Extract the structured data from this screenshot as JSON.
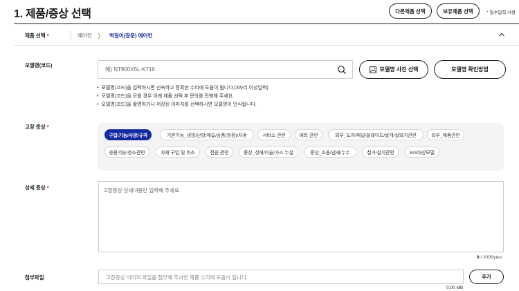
{
  "header": {
    "title": "1. 제품/증상 선택",
    "other_product_btn": "다른제품 선택",
    "owned_product_btn": "보유제품 선택",
    "required_star": "*",
    "required_note": "필수입력 사항"
  },
  "breadcrumb": {
    "label": "제품 선택",
    "star": "*",
    "level1": "에어컨",
    "separator": "〉",
    "level2": "벽걸이(창문) 에어컨"
  },
  "model": {
    "label": "모델명(코드)",
    "placeholder": "예) NT900X5L-K716",
    "photo_btn": "모델명 사진 선택",
    "howto_btn": "모델명 확인방법",
    "tips": [
      "모델명(코드)을 입력하시면 신속하고 정확한 수리에 도움이 됩니다.(3자리 이상입력)",
      "모델명(코드)을 모를 경우 아래 제품 선택 후 문의를 진행해 주세요.",
      "모델명(코드)을 촬영하거나 저장된 이미지를 선택하시면 모델명이 인식됩니다."
    ]
  },
  "symptom": {
    "label": "고장 증상",
    "star": "*",
    "chips": [
      "구입/기능/사양/규격",
      "기본기능_냉방/난방/제습/송풍(청정)/자동",
      "서비스 관련",
      "에러 관련",
      "외부_도어/패널/블레이드/날개/실외기관련",
      "외부_제품관련",
      "응용기능/청소관련",
      "자재 구입 및 취소",
      "전원 관련",
      "증상_성에/이슬/가스 누설",
      "증상_소음/냄새/누수",
      "철거/설치관련",
      "B/S대상모델"
    ],
    "active_index": 0
  },
  "detail": {
    "label": "상세 증상",
    "star": "*",
    "placeholder": "고장증상 상세내용만 입력해 주세요.",
    "byte_count": "0",
    "byte_limit": " / 300Bytes"
  },
  "attachment": {
    "label": "첨부파일",
    "placeholder": "고장증상 이미지 파일을 첨부해 주시면 제품 수리에 도움이 됩니다.",
    "add_btn": "추가",
    "size": "0.00 MB"
  },
  "colors": {
    "accent": "#1428a0",
    "required": "#d0021b",
    "chip_area_bg": "#f4f4f4"
  }
}
